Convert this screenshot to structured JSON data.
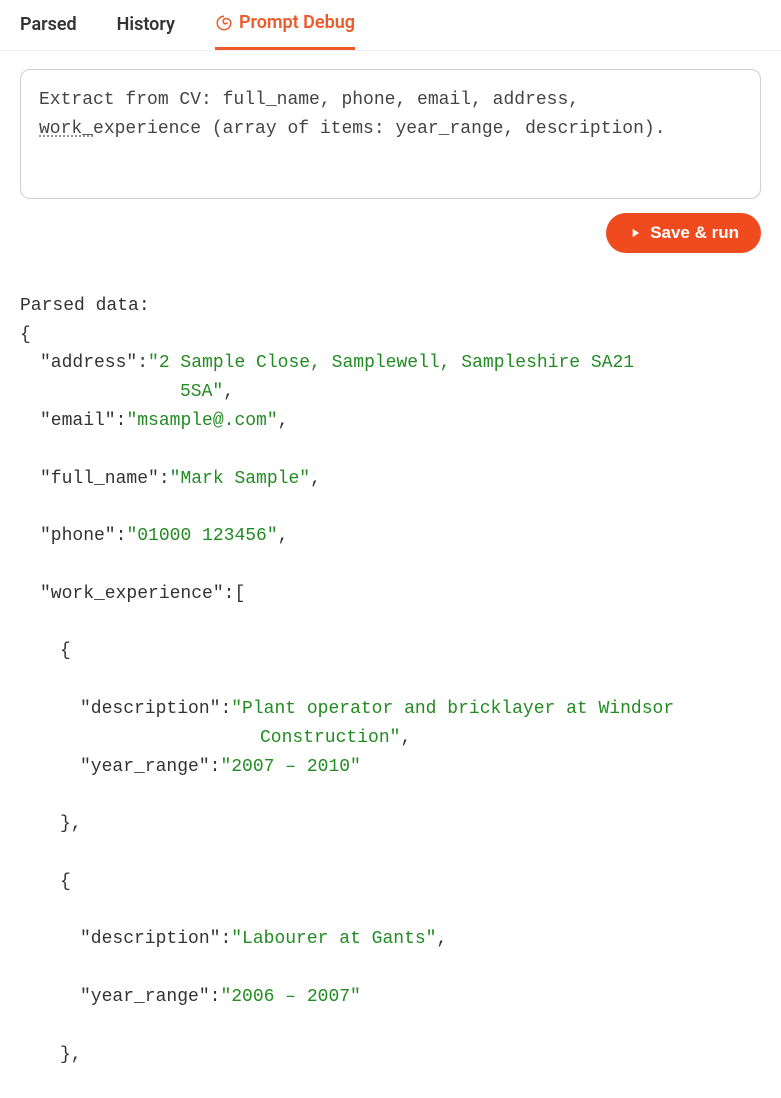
{
  "tabs": {
    "parsed": "Parsed",
    "history": "History",
    "prompt_debug": "Prompt Debug"
  },
  "prompt": {
    "line1a": "Extract from CV: full_name, phone, email, address,",
    "line2_underlined": "work_",
    "line2b": "experience (array of items: year_range, description)."
  },
  "actions": {
    "save_run": "Save & run"
  },
  "output": {
    "heading": "Parsed data:",
    "open_brace": "{",
    "address_key": "\"address\"",
    "address_val1": "\"2 Sample Close, Samplewell, Sampleshire SA21",
    "address_val2": "5SA\"",
    "email_key": "\"email\"",
    "email_val": "\"msample@.com\"",
    "fullname_key": "\"full_name\"",
    "fullname_val": "\"Mark Sample\"",
    "phone_key": "\"phone\"",
    "phone_val": "\"01000 123456\"",
    "we_key": "\"work_experience\"",
    "we_open": "[",
    "item_open": "{",
    "desc_key": "\"description\"",
    "we1_desc1": "\"Plant operator and bricklayer at Windsor",
    "we1_desc2": "Construction\"",
    "yr_key": "\"year_range\"",
    "we1_yr": "\"2007 – 2010\"",
    "item_close_c": "},",
    "we2_desc": "\"Labourer at Gants\"",
    "we2_yr": "\"2006 – 2007\""
  },
  "colors": {
    "accent": "#f04b1e",
    "string": "#228B22"
  }
}
